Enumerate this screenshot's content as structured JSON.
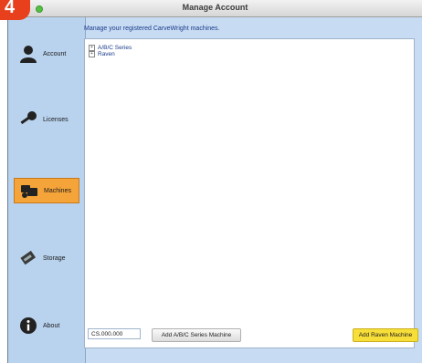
{
  "step_badge": "4",
  "window": {
    "title": "Manage Account"
  },
  "sidebar": {
    "items": [
      {
        "label": "Account",
        "icon": "user-icon",
        "active": false
      },
      {
        "label": "Licenses",
        "icon": "key-icon",
        "active": false
      },
      {
        "label": "Machines",
        "icon": "machines-icon",
        "active": true
      },
      {
        "label": "Storage",
        "icon": "memory-card-icon",
        "active": false
      },
      {
        "label": "About",
        "icon": "info-icon",
        "active": false
      }
    ]
  },
  "main": {
    "prompt": "Manage your registered CarveWright machines.",
    "tree": [
      {
        "label": "A/B/C Series",
        "expander": "+"
      },
      {
        "label": "Raven",
        "expander": "+"
      }
    ]
  },
  "bottom": {
    "serial_value": "CS.000.000",
    "add_abc_label": "Add A/B/C Series Machine",
    "add_raven_label": "Add Raven Machine"
  },
  "colors": {
    "active": "#f5a43a",
    "raven_button": "#f7de38",
    "window_bg": "#c7dcf2"
  }
}
